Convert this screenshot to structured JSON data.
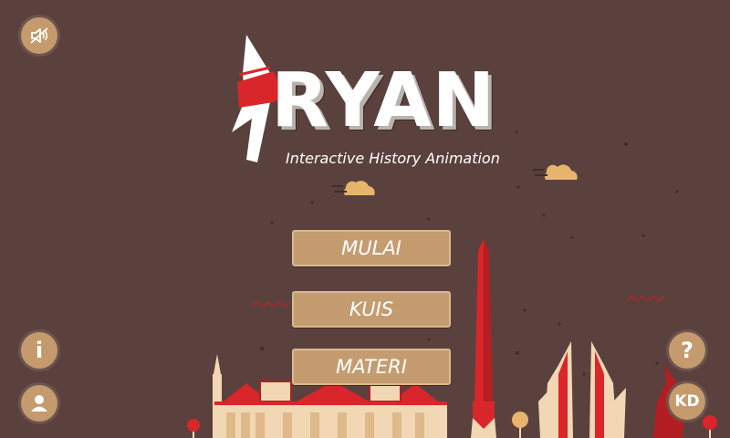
{
  "logo": {
    "title": "RYAN",
    "subtitle": "Interactive History Animation"
  },
  "menu": {
    "start_label": "MULAI",
    "quiz_label": "KUIS",
    "material_label": "MATERI"
  },
  "buttons": {
    "sound": {
      "icon": "speaker-muted-icon"
    },
    "info": {
      "label": "i"
    },
    "profile": {
      "icon": "user-icon"
    },
    "help": {
      "label": "?"
    },
    "kd": {
      "label": "KD"
    }
  },
  "colors": {
    "background": "#5a413d",
    "button": "#c49c70",
    "accent_red": "#d9262b"
  }
}
